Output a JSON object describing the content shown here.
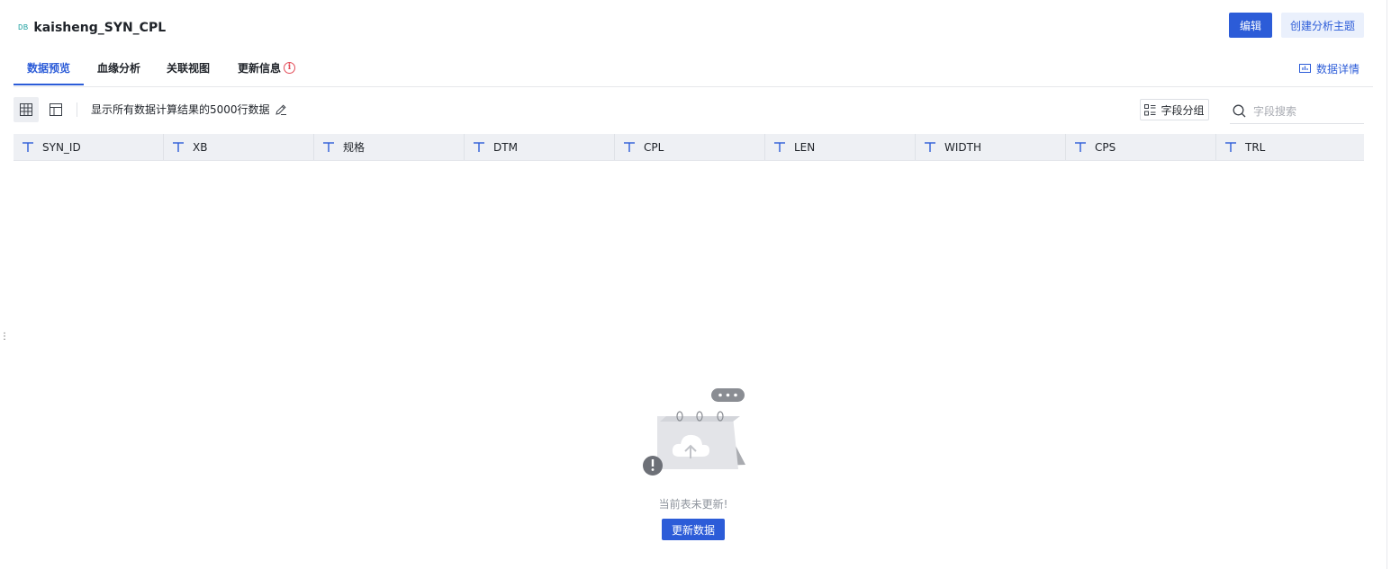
{
  "header": {
    "db_badge": "DB",
    "title": "kaisheng_SYN_CPL",
    "edit_label": "编辑",
    "create_topic_label": "创建分析主题"
  },
  "tabs": [
    {
      "label": "数据预览",
      "active": true
    },
    {
      "label": "血缘分析",
      "active": false
    },
    {
      "label": "关联视图",
      "active": false
    },
    {
      "label": "更新信息",
      "active": false
    }
  ],
  "data_detail_label": "数据详情",
  "toolbar": {
    "row_note": "显示所有数据计算结果的5000行数据",
    "group_label": "字段分组",
    "search_placeholder": "字段搜索"
  },
  "columns": [
    "SYN_ID",
    "XB",
    "规格",
    "DTM",
    "CPL",
    "LEN",
    "WIDTH",
    "CPS",
    "TRL"
  ],
  "empty": {
    "message": "当前表未更新!",
    "update_label": "更新数据"
  },
  "colors": {
    "accent": "#2c5cd8",
    "header_bg": "#eef0f4",
    "warning": "#e34d59"
  }
}
